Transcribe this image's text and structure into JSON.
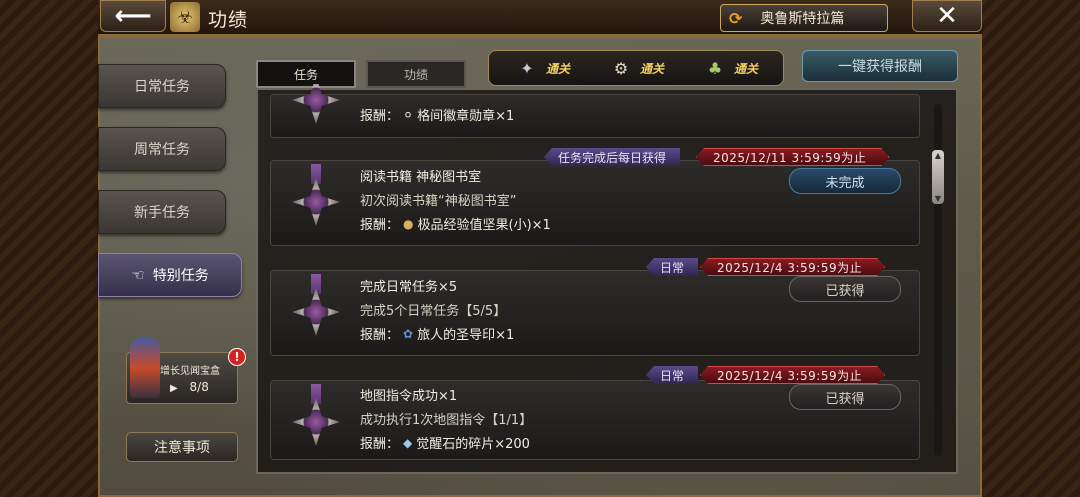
{
  "header": {
    "back_icon": "back-arrow-icon",
    "title": "功绩",
    "title_icon": "achievement-book-icon",
    "story_label": "奥鲁斯特拉篇",
    "close_icon": "close-icon"
  },
  "sidebar": {
    "items": [
      {
        "label": "日常任务"
      },
      {
        "label": "周常任务"
      },
      {
        "label": "新手任务"
      },
      {
        "label": "特别任务"
      }
    ],
    "growth_box": {
      "label": "增长见闻宝盒",
      "count": "8/8",
      "alert": "!"
    },
    "notes_label": "注意事项"
  },
  "tabs": [
    {
      "label": "任务"
    },
    {
      "label": "功绩"
    }
  ],
  "reward_strip": [
    {
      "icon": "silver-star-icon",
      "label": "通关"
    },
    {
      "icon": "gear-medal-icon",
      "label": "通关"
    },
    {
      "icon": "clover-icon",
      "label": "通关"
    }
  ],
  "claim_all_label": "一键获得报酬",
  "tasks": [
    {
      "reward_prefix": "报酬：",
      "reward": "格间徽章勋章×1"
    },
    {
      "tag": "任务完成后每日获得",
      "deadline": "2025/12/11  3:59:59为止",
      "title": "阅读书籍 神秘图书室",
      "desc": "初次阅读书籍“神秘图书室”",
      "reward_prefix": "报酬：",
      "reward": "极品经验值坚果(小)×1",
      "status": "未完成"
    },
    {
      "tag": "日常",
      "deadline": "2025/12/4  3:59:59为止",
      "title": "完成日常任务×5",
      "desc": "完成5个日常任务【5/5】",
      "reward_prefix": "报酬：",
      "reward": "旅人的圣导印×1",
      "status": "已获得"
    },
    {
      "tag": "日常",
      "deadline": "2025/12/4  3:59:59为止",
      "title": "地图指令成功×1",
      "desc": "成功执行1次地图指令【1/1】",
      "reward_prefix": "报酬：",
      "reward": "觉醒石的碎片×200",
      "status": "已获得"
    }
  ]
}
